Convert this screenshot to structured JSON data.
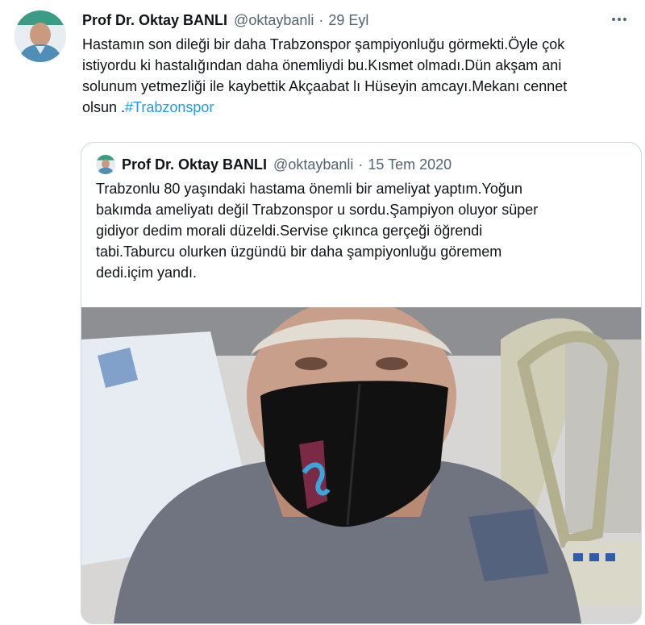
{
  "tweet": {
    "author_name": "Prof Dr. Oktay BANLI",
    "handle": "@oktaybanli",
    "separator": "·",
    "date": "29 Eyl",
    "text_line1": "Hastamın son dileği bir daha Trabzonspor şampiyonluğu görmekti.Öyle çok",
    "text_line2": "istiyordu ki hastalığından daha önemliydi bu.Kısmet olmadı.Dün akşam ani",
    "text_line3": "solunum yetmezliği ile kaybettik Akçaabat lı Hüseyin amcayı.Mekanı cennet",
    "text_line4_prefix": "olsun .",
    "hashtag": "#Trabzonspor",
    "more_icon": "more-horizontal-icon"
  },
  "quoted_tweet": {
    "author_name": "Prof Dr. Oktay BANLI",
    "handle": "@oktaybanli",
    "separator": "·",
    "date": "15 Tem 2020",
    "text_line1": "Trabzonlu 80 yaşındaki hastama önemli bir ameliyat yaptım.Yoğun",
    "text_line2": "bakımda ameliyatı değil Trabzonspor u sordu.Şampiyon oluyor süper",
    "text_line3": "gidiyor dedim morali düzeldi.Servise çıkınca gerçeği öğrendi",
    "text_line4": "tabi.Taburcu olurken üzgündü bir daha şampiyonluğu göremem",
    "text_line5": "dedi.içim yandı."
  },
  "colors": {
    "text": "#0f1419",
    "secondary": "#536471",
    "link": "#1d9bf0",
    "border": "#cfd9de",
    "mask": "#111111",
    "club_maroon": "#7a2a45",
    "club_blue": "#3aa6dc"
  }
}
